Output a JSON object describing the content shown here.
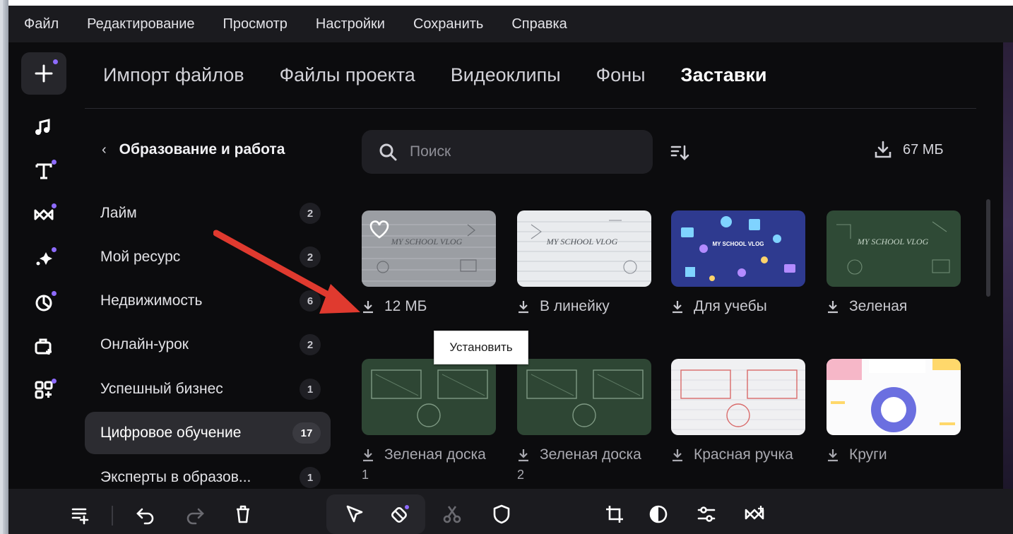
{
  "menu": [
    "Файл",
    "Редактирование",
    "Просмотр",
    "Настройки",
    "Сохранить",
    "Справка"
  ],
  "left_tools": [
    "add-icon",
    "music-icon",
    "text-icon",
    "transition-icon",
    "effects-icon",
    "sticker-icon",
    "toolbox-icon",
    "widgets-icon"
  ],
  "tabs": [
    "Импорт файлов",
    "Файлы проекта",
    "Видеоклипы",
    "Фоны",
    "Заставки"
  ],
  "active_tab": "Заставки",
  "category_panel": {
    "back_title": "Образование и работа",
    "items": [
      {
        "label": "Лайм",
        "count": "2"
      },
      {
        "label": "Мой ресурс",
        "count": "2"
      },
      {
        "label": "Недвижимость",
        "count": "6"
      },
      {
        "label": "Онлайн-урок",
        "count": "2"
      },
      {
        "label": "Успешный бизнес",
        "count": "1"
      },
      {
        "label": "Цифровое обучение",
        "count": "17"
      },
      {
        "label": "Эксперты в образов...",
        "count": "1"
      }
    ],
    "active_index": 5
  },
  "search": {
    "placeholder": "Поиск"
  },
  "total_size": "67 МБ",
  "cards": [
    {
      "caption": "12 МБ",
      "thumb_text": "MY SCHOOL VLOG"
    },
    {
      "caption": "В линейку",
      "thumb_text": "MY SCHOOL VLOG"
    },
    {
      "caption": "Для учебы",
      "thumb_text": "MY SCHOOL VLOG"
    },
    {
      "caption": "Зеленая",
      "thumb_text": "MY SCHOOL VLOG"
    },
    {
      "caption": "Зеленая доска",
      "caption_line2": "1"
    },
    {
      "caption": "Зеленая доска",
      "caption_line2": "2"
    },
    {
      "caption": "Красная ручка"
    },
    {
      "caption": "Круги"
    }
  ],
  "tooltip": "Установить",
  "bottom_tools": [
    "add-track-icon",
    "undo-icon",
    "redo-icon",
    "delete-icon",
    "select-icon",
    "eraser-icon",
    "cut-icon",
    "shield-icon",
    "crop-icon",
    "color-icon",
    "adjust-icon",
    "transition-icon"
  ],
  "colors": {
    "background": "#0c0c0e",
    "panel": "#1b1b1f",
    "accent_dot": "#8e6bff",
    "arrow": "#e03a2f"
  }
}
